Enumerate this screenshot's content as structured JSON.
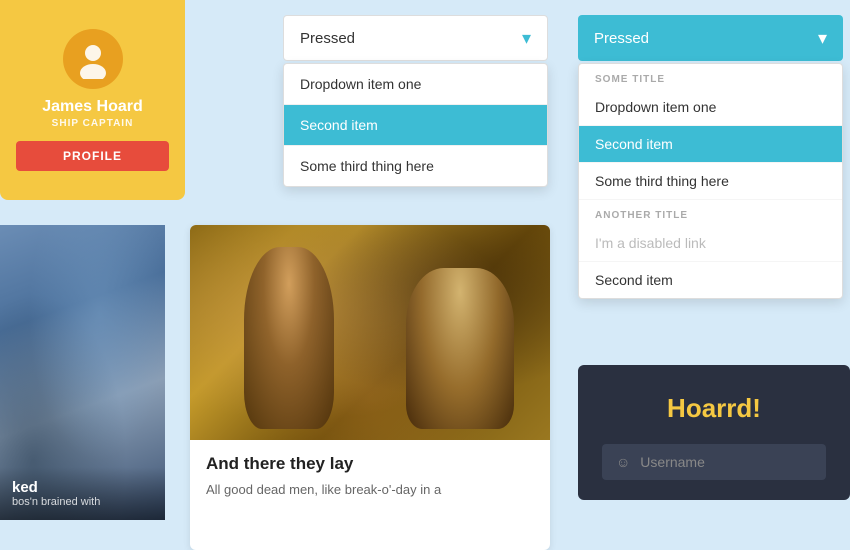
{
  "profile": {
    "name": "James Hoard",
    "title": "SHIP CAPTAIN",
    "btn_label": "PROFILE"
  },
  "dropdown1": {
    "trigger_label": "Pressed",
    "items": [
      {
        "label": "Dropdown item one",
        "active": false
      },
      {
        "label": "Second item",
        "active": true
      },
      {
        "label": "Some third thing here",
        "active": false
      }
    ]
  },
  "dropdown2": {
    "trigger_label": "Pressed",
    "groups": [
      {
        "title": "SOME TITLE",
        "items": [
          {
            "label": "Dropdown item one",
            "active": false,
            "disabled": false
          },
          {
            "label": "Second item",
            "active": true,
            "disabled": false
          },
          {
            "label": "Some third thing here",
            "active": false,
            "disabled": false
          }
        ]
      },
      {
        "title": "ANOTHER TITLE",
        "items": [
          {
            "label": "I'm a disabled link",
            "active": false,
            "disabled": true
          },
          {
            "label": "Second item",
            "active": false,
            "disabled": false
          }
        ]
      }
    ]
  },
  "card_left": {
    "text_main": "ked",
    "text_sub": "bos'n brained with"
  },
  "card_main": {
    "title": "And there they lay",
    "text": "All good dead men, like break-o'-day in a"
  },
  "login": {
    "title": "Hoarrd!",
    "username_placeholder": "Username"
  }
}
